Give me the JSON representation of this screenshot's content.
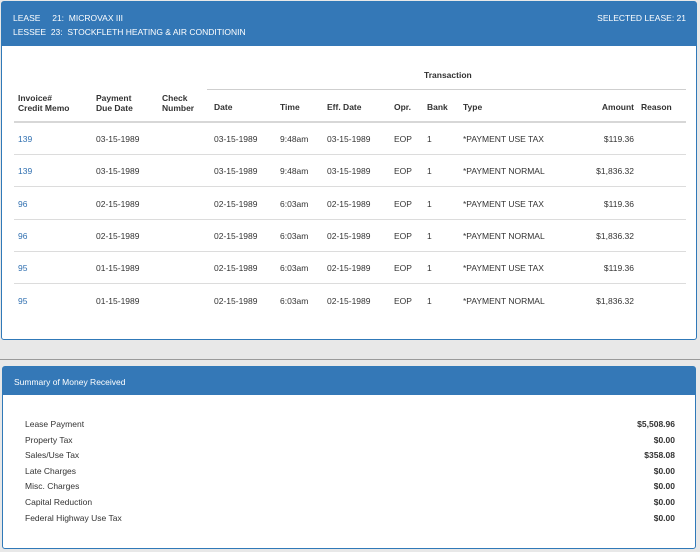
{
  "header": {
    "lease_label": "LEASE",
    "lease_number": "21:",
    "lease_name": "MICROVAX III",
    "lessee_label": "LESSEE",
    "lessee_number": "23:",
    "lessee_name": "STOCKFLETH HEATING & AIR CONDITIONIN",
    "selected_lease": "SELECTED LEASE: 21"
  },
  "table": {
    "group_label": "Transaction",
    "columns": {
      "invoice_line1": "Invoice#",
      "invoice_line2": "Credit Memo",
      "payment_line1": "Payment",
      "payment_line2": "Due Date",
      "check_line1": "Check",
      "check_line2": "Number",
      "date": "Date",
      "time": "Time",
      "eff_date": "Eff. Date",
      "opr": "Opr.",
      "bank": "Bank",
      "type": "Type",
      "amount": "Amount",
      "reason": "Reason"
    },
    "rows": [
      {
        "invoice": "139",
        "due_date": "03-15-1989",
        "check": "",
        "date": "03-15-1989",
        "time": "9:48am",
        "eff_date": "03-15-1989",
        "opr": "EOP",
        "bank": "1",
        "type": "*PAYMENT USE TAX",
        "amount": "$119.36",
        "reason": ""
      },
      {
        "invoice": "139",
        "due_date": "03-15-1989",
        "check": "",
        "date": "03-15-1989",
        "time": "9:48am",
        "eff_date": "03-15-1989",
        "opr": "EOP",
        "bank": "1",
        "type": "*PAYMENT NORMAL",
        "amount": "$1,836.32",
        "reason": ""
      },
      {
        "invoice": "96",
        "due_date": "02-15-1989",
        "check": "",
        "date": "02-15-1989",
        "time": "6:03am",
        "eff_date": "02-15-1989",
        "opr": "EOP",
        "bank": "1",
        "type": "*PAYMENT USE TAX",
        "amount": "$119.36",
        "reason": ""
      },
      {
        "invoice": "96",
        "due_date": "02-15-1989",
        "check": "",
        "date": "02-15-1989",
        "time": "6:03am",
        "eff_date": "02-15-1989",
        "opr": "EOP",
        "bank": "1",
        "type": "*PAYMENT NORMAL",
        "amount": "$1,836.32",
        "reason": ""
      },
      {
        "invoice": "95",
        "due_date": "01-15-1989",
        "check": "",
        "date": "02-15-1989",
        "time": "6:03am",
        "eff_date": "02-15-1989",
        "opr": "EOP",
        "bank": "1",
        "type": "*PAYMENT USE TAX",
        "amount": "$119.36",
        "reason": ""
      },
      {
        "invoice": "95",
        "due_date": "01-15-1989",
        "check": "",
        "date": "02-15-1989",
        "time": "6:03am",
        "eff_date": "02-15-1989",
        "opr": "EOP",
        "bank": "1",
        "type": "*PAYMENT NORMAL",
        "amount": "$1,836.32",
        "reason": ""
      }
    ]
  },
  "summary": {
    "title": "Summary of Money Received",
    "items": [
      {
        "label": "Lease Payment",
        "value": "$5,508.96"
      },
      {
        "label": "Property Tax",
        "value": "$0.00"
      },
      {
        "label": "Sales/Use Tax",
        "value": "$358.08"
      },
      {
        "label": "Late Charges",
        "value": "$0.00"
      },
      {
        "label": "Misc. Charges",
        "value": "$0.00"
      },
      {
        "label": "Capital Reduction",
        "value": "$0.00"
      },
      {
        "label": "Federal Highway Use Tax",
        "value": "$0.00"
      }
    ]
  },
  "colors": {
    "header_blue": "#3478b7",
    "link_blue": "#2f6fb0"
  }
}
